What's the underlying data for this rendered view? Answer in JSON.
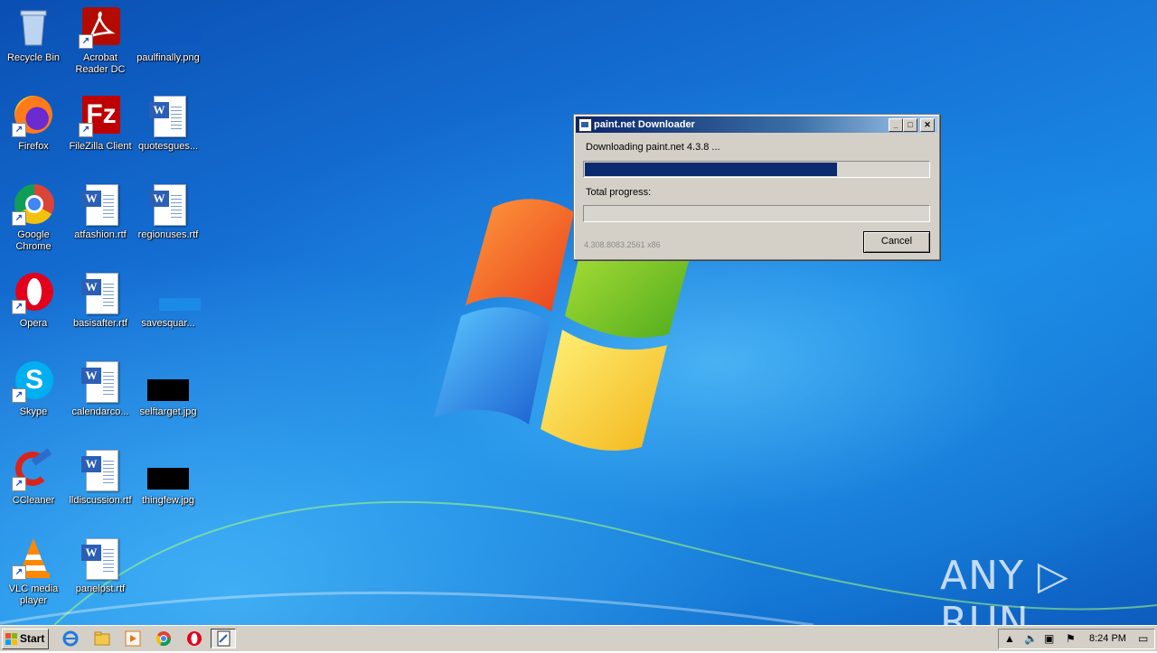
{
  "desktop_icons": [
    {
      "label": "Recycle Bin",
      "icon": "recycle-bin-icon"
    },
    {
      "label": "Acrobat Reader DC",
      "icon": "acrobat-icon"
    },
    {
      "label": "paulfinally.png",
      "icon": "image-file-icon"
    },
    {
      "label": "Firefox",
      "icon": "firefox-icon"
    },
    {
      "label": "FileZilla Client",
      "icon": "filezilla-icon"
    },
    {
      "label": "quotesgues...",
      "icon": "word-doc-icon"
    },
    {
      "label": "Google Chrome",
      "icon": "chrome-icon"
    },
    {
      "label": "atfashion.rtf",
      "icon": "word-doc-icon"
    },
    {
      "label": "regionuses.rtf",
      "icon": "word-doc-icon"
    },
    {
      "label": "Opera",
      "icon": "opera-icon"
    },
    {
      "label": "basisafter.rtf",
      "icon": "word-doc-icon"
    },
    {
      "label": "savesquar...",
      "icon": "image-file-icon"
    },
    {
      "label": "Skype",
      "icon": "skype-icon"
    },
    {
      "label": "calendarco...",
      "icon": "word-doc-icon"
    },
    {
      "label": "selftarget.jpg",
      "icon": "image-file-icon"
    },
    {
      "label": "CCleaner",
      "icon": "ccleaner-icon"
    },
    {
      "label": "lldiscussion.rtf",
      "icon": "word-doc-icon"
    },
    {
      "label": "thingfew.jpg",
      "icon": "image-file-icon"
    },
    {
      "label": "VLC media player",
      "icon": "vlc-icon"
    },
    {
      "label": "panelpst.rtf",
      "icon": "word-doc-icon"
    }
  ],
  "dialog": {
    "title": "paint.net Downloader",
    "downloading_label": "Downloading paint.net 4.3.8 ...",
    "download_progress": 0.73,
    "total_label": "Total progress:",
    "total_progress": 0.0,
    "version": "4.308.8083.2561 x86",
    "cancel_label": "Cancel",
    "min_glyph": "_",
    "max_glyph": "□",
    "close_glyph": "✕"
  },
  "taskbar": {
    "start_label": "Start",
    "clock": "8:24 PM",
    "icons": [
      "internet-explorer-icon",
      "explorer-icon",
      "media-player-icon",
      "chrome-icon",
      "opera-icon",
      "paintnet-installer-icon"
    ]
  },
  "watermark": "ANY ▷ RUN",
  "colors": {
    "progress_fill": "#0b2a6f",
    "title_gradient_start": "#0a246a",
    "desktop_blue": "#1672d6"
  }
}
